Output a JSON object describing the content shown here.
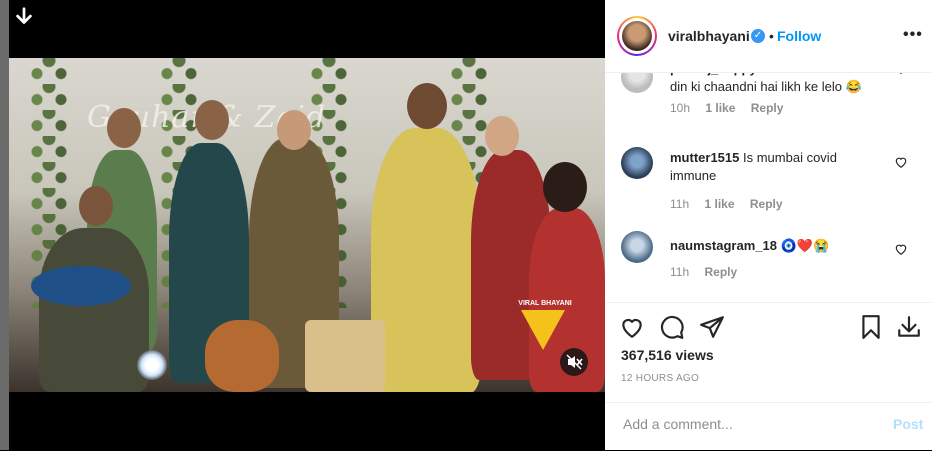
{
  "video": {
    "watermark": "VIRAL BHAYANI",
    "stage_text": "Gauhar & Zaid"
  },
  "post": {
    "username": "viralbhayani",
    "follow_label": "Follow",
    "separator": "•",
    "more_label": "•••"
  },
  "comments": [
    {
      "username": "pankaj_happysoul",
      "text": "Ye shaadi do din ki chaandni hai likh ke lelo 😂",
      "time": "10h",
      "likes": "1 like",
      "reply": "Reply"
    },
    {
      "username": "mutter1515",
      "text": "Is mumbai covid immune",
      "time": "11h",
      "likes": "1 like",
      "reply": "Reply"
    },
    {
      "username": "naumstagram_18",
      "text": "🧿❤️😭",
      "time": "11h",
      "reply": "Reply"
    }
  ],
  "stats": {
    "views": "367,516 views",
    "posted": "12 HOURS AGO"
  },
  "composer": {
    "placeholder": "Add a comment...",
    "post_label": "Post"
  },
  "icons": {
    "download": "download-arrow-icon",
    "mute": "speaker-muted-icon",
    "like": "heart-icon",
    "comment": "comment-bubble-icon",
    "share": "paper-plane-icon",
    "save": "bookmark-icon",
    "save_to_device": "tray-download-icon"
  },
  "colors": {
    "accent": "#0095f6",
    "post_disabled": "#b2dffc",
    "muted_text": "#8e8e8e"
  }
}
